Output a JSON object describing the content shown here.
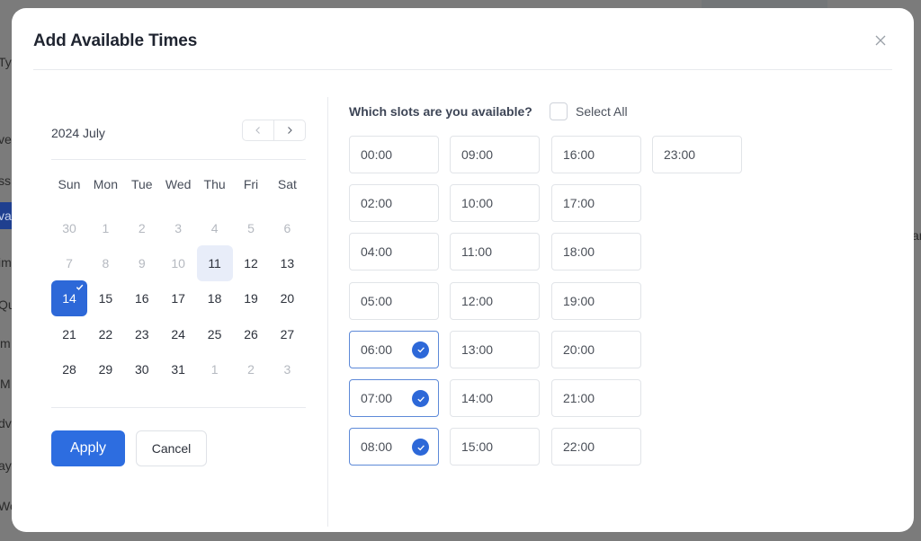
{
  "background": {
    "left_fragments": [
      {
        "text": "Ty",
        "active": false
      },
      {
        "text": "ve",
        "active": false
      },
      {
        "text": "ss",
        "active": false
      },
      {
        "text": "va",
        "active": true
      },
      {
        "text": "im",
        "active": false
      },
      {
        "text": "Qu",
        "active": false
      },
      {
        "text": "m",
        "active": false
      },
      {
        "text": "M",
        "active": false
      },
      {
        "text": "dv",
        "active": false
      },
      {
        "text": "ay",
        "active": false
      },
      {
        "text": "We",
        "active": false
      }
    ],
    "right_fragment": "ar"
  },
  "modal": {
    "title": "Add Available Times",
    "close_icon": "close-icon"
  },
  "calendar": {
    "month_label": "2024 July",
    "prev_icon": "chevron-left-icon",
    "next_icon": "chevron-right-icon",
    "weekdays": [
      "Sun",
      "Mon",
      "Tue",
      "Wed",
      "Thu",
      "Fri",
      "Sat"
    ],
    "weeks": [
      [
        {
          "d": "30",
          "state": "muted"
        },
        {
          "d": "1",
          "state": "muted"
        },
        {
          "d": "2",
          "state": "muted"
        },
        {
          "d": "3",
          "state": "muted"
        },
        {
          "d": "4",
          "state": "muted"
        },
        {
          "d": "5",
          "state": "muted"
        },
        {
          "d": "6",
          "state": "muted"
        }
      ],
      [
        {
          "d": "7",
          "state": "muted"
        },
        {
          "d": "8",
          "state": "muted"
        },
        {
          "d": "9",
          "state": "muted"
        },
        {
          "d": "10",
          "state": "muted"
        },
        {
          "d": "11",
          "state": "hover"
        },
        {
          "d": "12",
          "state": "normal"
        },
        {
          "d": "13",
          "state": "normal"
        }
      ],
      [
        {
          "d": "14",
          "state": "selected"
        },
        {
          "d": "15",
          "state": "normal"
        },
        {
          "d": "16",
          "state": "normal"
        },
        {
          "d": "17",
          "state": "normal"
        },
        {
          "d": "18",
          "state": "normal"
        },
        {
          "d": "19",
          "state": "normal"
        },
        {
          "d": "20",
          "state": "normal"
        }
      ],
      [
        {
          "d": "21",
          "state": "normal"
        },
        {
          "d": "22",
          "state": "normal"
        },
        {
          "d": "23",
          "state": "normal"
        },
        {
          "d": "24",
          "state": "normal"
        },
        {
          "d": "25",
          "state": "normal"
        },
        {
          "d": "26",
          "state": "normal"
        },
        {
          "d": "27",
          "state": "normal"
        }
      ],
      [
        {
          "d": "28",
          "state": "normal"
        },
        {
          "d": "29",
          "state": "normal"
        },
        {
          "d": "30",
          "state": "normal"
        },
        {
          "d": "31",
          "state": "normal"
        },
        {
          "d": "1",
          "state": "muted"
        },
        {
          "d": "2",
          "state": "muted"
        },
        {
          "d": "3",
          "state": "muted"
        }
      ]
    ],
    "selected_date": "14",
    "apply_label": "Apply",
    "cancel_label": "Cancel"
  },
  "slots": {
    "heading": "Which slots are you available?",
    "select_all_label": "Select All",
    "select_all_checked": false,
    "columns": [
      [
        {
          "time": "00:00",
          "selected": false
        },
        {
          "time": "02:00",
          "selected": false
        },
        {
          "time": "04:00",
          "selected": false
        },
        {
          "time": "05:00",
          "selected": false
        },
        {
          "time": "06:00",
          "selected": true
        },
        {
          "time": "07:00",
          "selected": true
        },
        {
          "time": "08:00",
          "selected": true
        }
      ],
      [
        {
          "time": "09:00",
          "selected": false
        },
        {
          "time": "10:00",
          "selected": false
        },
        {
          "time": "11:00",
          "selected": false
        },
        {
          "time": "12:00",
          "selected": false
        },
        {
          "time": "13:00",
          "selected": false
        },
        {
          "time": "14:00",
          "selected": false
        },
        {
          "time": "15:00",
          "selected": false
        }
      ],
      [
        {
          "time": "16:00",
          "selected": false
        },
        {
          "time": "17:00",
          "selected": false
        },
        {
          "time": "18:00",
          "selected": false
        },
        {
          "time": "19:00",
          "selected": false
        },
        {
          "time": "20:00",
          "selected": false
        },
        {
          "time": "21:00",
          "selected": false
        },
        {
          "time": "22:00",
          "selected": false
        }
      ],
      [
        {
          "time": "23:00",
          "selected": false
        }
      ]
    ]
  },
  "colors": {
    "accent": "#2d68d8",
    "overlay": "#7b7b7b",
    "hover_day": "#e8edf9",
    "selected_slot_border": "#5d89d8"
  }
}
